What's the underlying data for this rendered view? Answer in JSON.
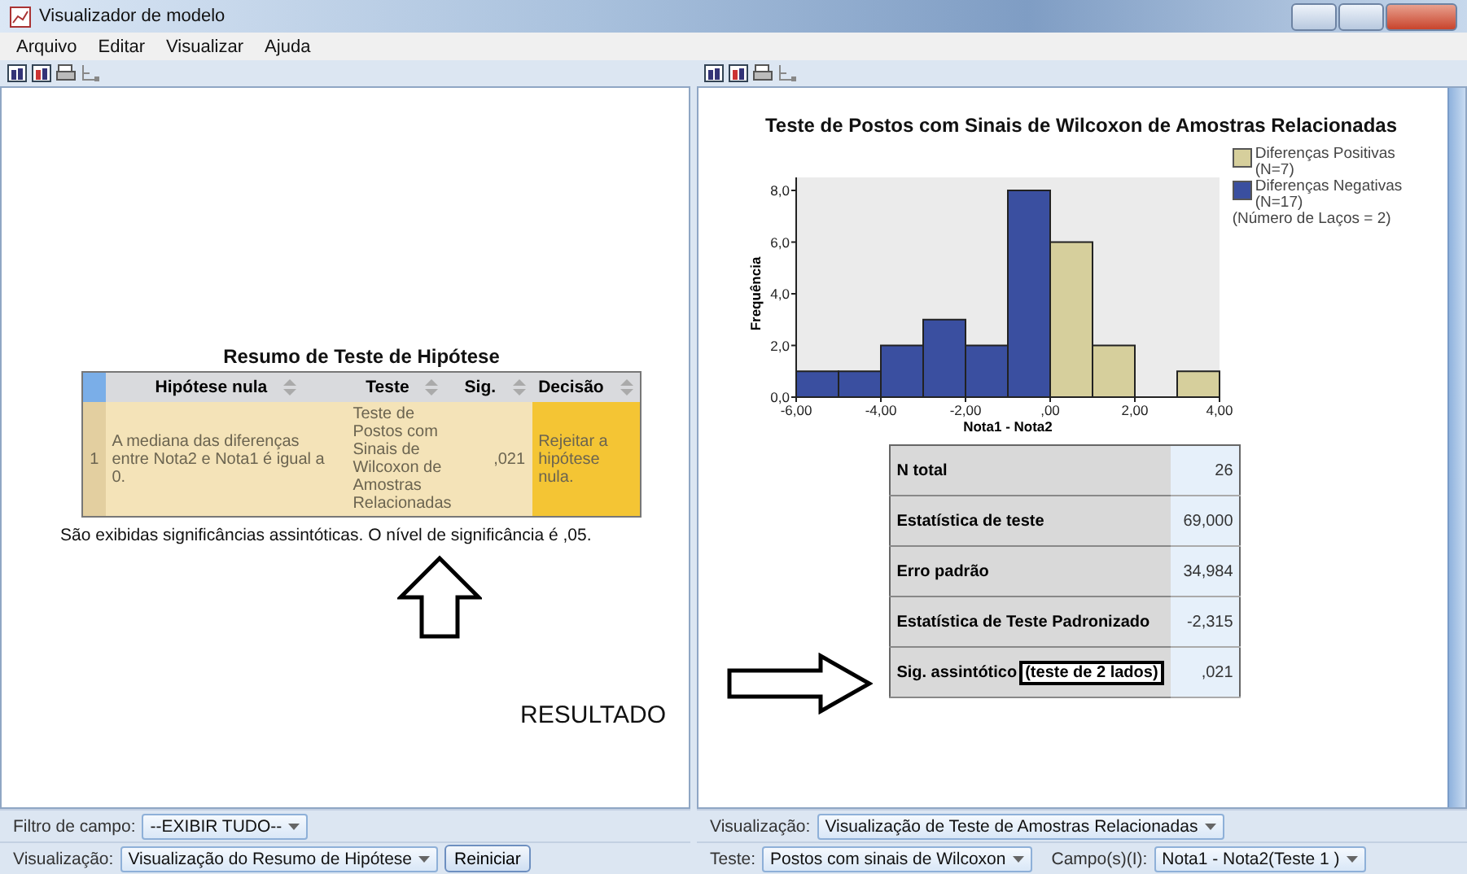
{
  "window": {
    "title": "Visualizador de modelo"
  },
  "menu": [
    "Arquivo",
    "Editar",
    "Visualizar",
    "Ajuda"
  ],
  "left_pane": {
    "summary": {
      "title": "Resumo de Teste de Hipótese",
      "columns": [
        "Hipótese nula",
        "Teste",
        "Sig.",
        "Decisão"
      ],
      "rows": [
        {
          "number": "1",
          "hypothesis": "A mediana das diferenças entre Nota2 e Nota1 é igual a 0.",
          "test": "Teste de Postos com Sinais de Wilcoxon de Amostras Relacionadas",
          "sig": ",021",
          "decision": "Rejeitar a hipótese nula."
        }
      ],
      "footnote": "São exibidas significâncias assintóticas.  O nível de significância é ,05."
    },
    "result_label": "RESULTADO",
    "field_filter": {
      "label": "Filtro de campo:",
      "value": "--EXIBIR TUDO--"
    },
    "view": {
      "label": "Visualização:",
      "value": "Visualização do Resumo de Hipótese"
    },
    "reset_button": "Reiniciar"
  },
  "right_pane": {
    "chart_data": {
      "type": "bar",
      "title": "Teste de Postos com Sinais de Wilcoxon de Amostras Relacionadas",
      "xlabel": "Nota1 - Nota2",
      "ylabel": "Frequência",
      "x": [
        -6,
        -5,
        -4,
        -3,
        -2,
        -1,
        0,
        1,
        2,
        3
      ],
      "series": [
        {
          "name": "Diferenças Positivas",
          "color": "#d6cf9c",
          "values": [
            null,
            null,
            null,
            null,
            null,
            null,
            6,
            2,
            null,
            1
          ]
        },
        {
          "name": "Diferenças Negativas",
          "color": "#3a4fa0",
          "values": [
            1,
            1,
            2,
            3,
            2,
            8,
            null,
            null,
            null,
            null
          ]
        }
      ],
      "xlim": [
        -6,
        4
      ],
      "ylim": [
        0,
        8
      ],
      "xticks": [
        {
          "value": -6,
          "label": "-6,00"
        },
        {
          "value": -4,
          "label": "-4,00"
        },
        {
          "value": -2,
          "label": "-2,00"
        },
        {
          "value": 0,
          "label": ",00"
        },
        {
          "value": 2,
          "label": "2,00"
        },
        {
          "value": 4,
          "label": "4,00"
        }
      ],
      "yticks": [
        {
          "value": 0,
          "label": "0,0"
        },
        {
          "value": 2,
          "label": "2,0"
        },
        {
          "value": 4,
          "label": "4,0"
        },
        {
          "value": 6,
          "label": "6,0"
        },
        {
          "value": 8,
          "label": "8,0"
        }
      ]
    },
    "legend": [
      {
        "note": "(N=7)"
      },
      {
        "note": "(N=17)"
      }
    ],
    "legend_note": "(Número de Laços = 2)",
    "stats": [
      {
        "label": "N total",
        "value": "26"
      },
      {
        "label": "Estatística de teste",
        "value": "69,000"
      },
      {
        "label": "Erro padrão",
        "value": "34,984"
      },
      {
        "label": "Estatística de Teste Padronizado",
        "value": "-2,315"
      },
      {
        "label": "Sig. assintótico",
        "boxed_note": "(teste de 2 lados)",
        "value": ",021"
      }
    ],
    "view": {
      "label": "Visualização:",
      "value": "Visualização de Teste de Amostras Relacionadas"
    },
    "test": {
      "label": "Teste:",
      "value": "Postos com sinais de Wilcoxon"
    },
    "fields": {
      "label": "Campo(s)(I):",
      "value": "Nota1 - Nota2(Teste 1 )"
    }
  }
}
